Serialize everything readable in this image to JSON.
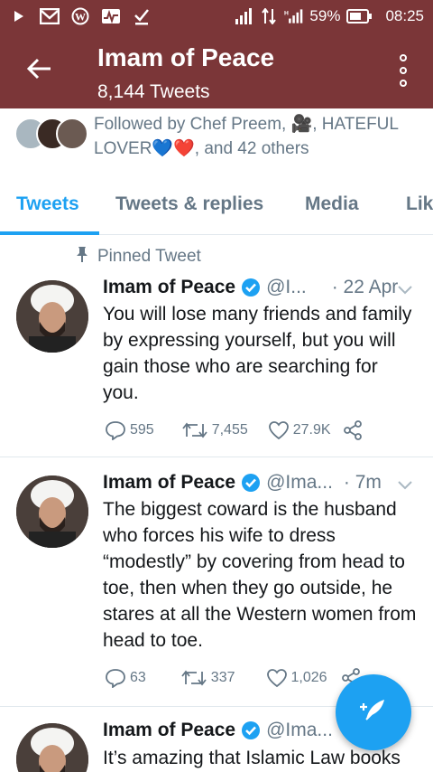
{
  "status_bar": {
    "battery": "59%",
    "time": "08:25",
    "bar_color": "#7b3638"
  },
  "header": {
    "title": "Imam of Peace",
    "subtitle": "8,144 Tweets",
    "back_icon": "arrow-left-icon",
    "more_icon": "vertical-dots-icon"
  },
  "followed": {
    "text_a": "Followed by Chef Preem, 🎥, HATEFUL LOVER",
    "heart_blue": "💙",
    "heart_red": "❤️",
    "text_b": ", and 42 others"
  },
  "tabs": [
    {
      "label": "Tweets",
      "active": true
    },
    {
      "label": "Tweets & replies",
      "active": false
    },
    {
      "label": "Media",
      "active": false
    },
    {
      "label": "Lik",
      "active": false
    }
  ],
  "accent_color": "#1da1f2",
  "pinned_label": "Pinned Tweet",
  "tweets": [
    {
      "name": "Imam of Peace",
      "handle": "@I...",
      "time": "· 22 Apr",
      "text": "You will lose many friends and family by expressing yourself, but you will gain those who are searching for you.",
      "replies": "595",
      "retweets": "7,455",
      "likes": "27.9K"
    },
    {
      "name": "Imam of Peace",
      "handle": "@Ima...",
      "time": "· 7m",
      "text": "The biggest coward is the husband who forces his wife to dress “modestly” by covering from head to toe, then when they go outside, he stares at all the Western women from head to toe.",
      "replies": "63",
      "retweets": "337",
      "likes": "1,026"
    },
    {
      "name": "Imam of Peace",
      "handle": "@Ima...",
      "time": "",
      "text": "It’s amazing that Islamic Law books"
    }
  ],
  "fab_icon": "compose-tweet-icon"
}
